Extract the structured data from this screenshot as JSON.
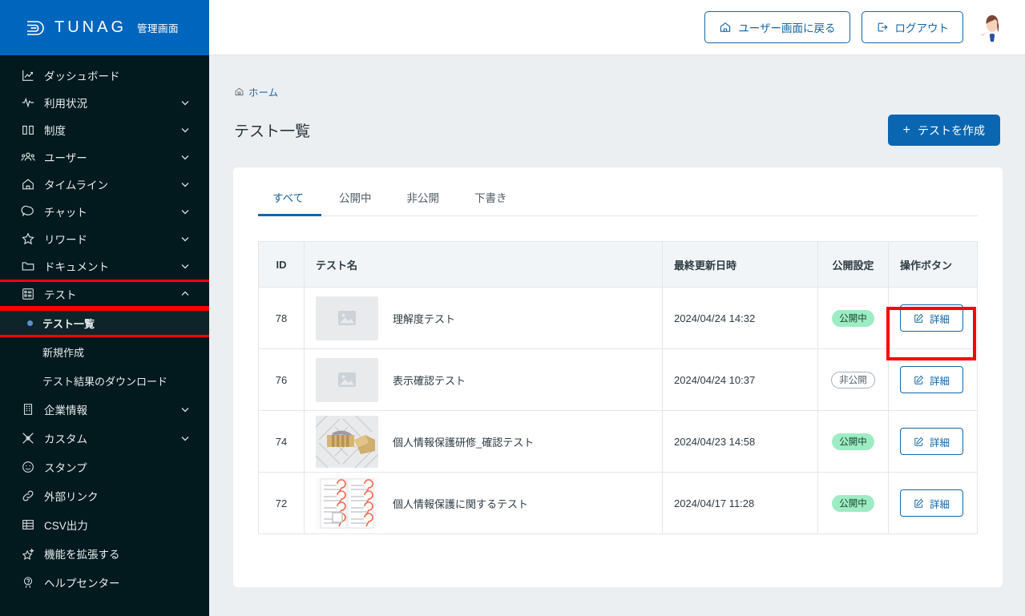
{
  "brand": {
    "name": "TUNAG",
    "subtitle": "管理画面",
    "logo_icon": "tunag-logo-icon"
  },
  "header": {
    "back_to_user_label": "ユーザー画面に戻る",
    "back_to_user_icon": "home-icon",
    "logout_label": "ログアウト",
    "logout_icon": "logout-icon",
    "avatar_icon": "user-avatar"
  },
  "sidebar": {
    "background": "#02191e",
    "brand_background": "#0065bd",
    "items": [
      {
        "label": "ダッシュボード",
        "icon": "chart-line-icon",
        "expandable": false
      },
      {
        "label": "利用状況",
        "icon": "activity-pulse-icon",
        "expandable": true
      },
      {
        "label": "制度",
        "icon": "book-open-icon",
        "expandable": true
      },
      {
        "label": "ユーザー",
        "icon": "users-icon",
        "expandable": true
      },
      {
        "label": "タイムライン",
        "icon": "home-outline-icon",
        "expandable": true
      },
      {
        "label": "チャット",
        "icon": "chat-bubble-icon",
        "expandable": true
      },
      {
        "label": "リワード",
        "icon": "star-icon",
        "expandable": true
      },
      {
        "label": "ドキュメント",
        "icon": "folder-icon",
        "expandable": true
      },
      {
        "label": "テスト",
        "icon": "test-list-icon",
        "expandable": true,
        "expanded": true,
        "highlighted": true
      },
      {
        "label": "テスト一覧",
        "icon": "dot-icon",
        "sub": true,
        "active": true,
        "highlighted": true
      },
      {
        "label": "新規作成",
        "sub": true
      },
      {
        "label": "テスト結果のダウンロード",
        "sub": true
      },
      {
        "label": "企業情報",
        "icon": "building-icon",
        "expandable": true
      },
      {
        "label": "カスタム",
        "icon": "custom-icon",
        "expandable": true
      },
      {
        "label": "スタンプ",
        "icon": "smiley-icon",
        "expandable": false
      },
      {
        "label": "外部リンク",
        "icon": "link-icon",
        "expandable": false
      },
      {
        "label": "CSV出力",
        "icon": "table-icon",
        "expandable": false
      },
      {
        "label": "機能を拡張する",
        "icon": "star-sparkle-icon",
        "expandable": false
      },
      {
        "label": "ヘルプセンター",
        "icon": "question-icon",
        "expandable": false
      }
    ]
  },
  "breadcrumb": {
    "icon": "home-small-icon",
    "items": [
      "ホーム"
    ]
  },
  "page": {
    "title": "テスト一覧",
    "create_button_label": "テストを作成",
    "create_button_plus": "+",
    "accent_color": "#0b66b2"
  },
  "tabs": [
    {
      "label": "すべて",
      "active": true
    },
    {
      "label": "公開中",
      "active": false
    },
    {
      "label": "非公開",
      "active": false
    },
    {
      "label": "下書き",
      "active": false
    }
  ],
  "table": {
    "columns": [
      "ID",
      "テスト名",
      "最終更新日時",
      "公開設定",
      "操作ボタン"
    ],
    "rows": [
      {
        "id": "78",
        "name": "理解度テスト",
        "thumbnail": "placeholder-image",
        "updated_at": "2024/04/24 14:32",
        "status": "公開中",
        "status_type": "public",
        "action_label": "詳細",
        "action_icon": "edit-square-icon",
        "highlighted": true
      },
      {
        "id": "76",
        "name": "表示確認テスト",
        "thumbnail": "placeholder-image",
        "updated_at": "2024/04/24 10:37",
        "status": "非公開",
        "status_type": "private",
        "action_label": "詳細",
        "action_icon": "edit-square-icon",
        "highlighted": false
      },
      {
        "id": "74",
        "name": "個人情報保護研修_確認テスト",
        "thumbnail": "padlock-on-keyboard-photo",
        "updated_at": "2024/04/23 14:58",
        "status": "公開中",
        "status_type": "public",
        "action_label": "詳細",
        "action_icon": "edit-square-icon",
        "highlighted": false
      },
      {
        "id": "72",
        "name": "個人情報保護に関するテスト",
        "thumbnail": "checked-document-photo",
        "updated_at": "2024/04/17 11:28",
        "status": "公開中",
        "status_type": "public",
        "action_label": "詳細",
        "action_icon": "edit-square-icon",
        "highlighted": false
      }
    ]
  },
  "annotations": {
    "color": "#ff0000",
    "boxes": [
      "sidebar-test-menu",
      "sidebar-test-list-item",
      "detail-button-row-78"
    ]
  }
}
